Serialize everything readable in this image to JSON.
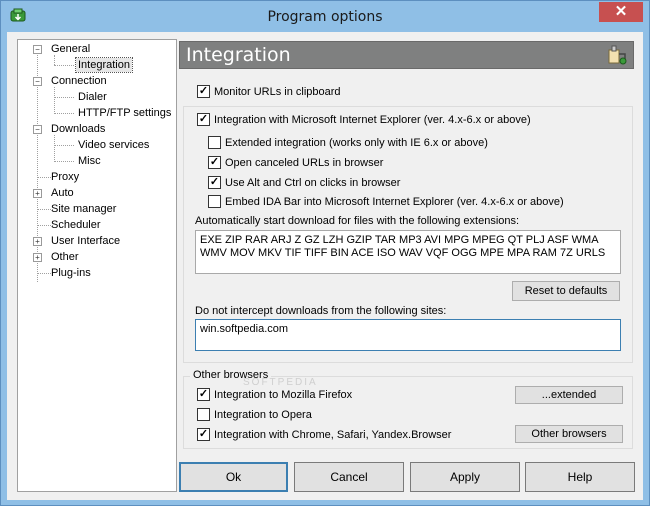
{
  "window": {
    "title": "Program options",
    "close_glyph": "✕"
  },
  "sidebar": {
    "items": [
      {
        "label": "General",
        "expanded": true
      },
      {
        "label": "Integration",
        "selected": true
      },
      {
        "label": "Connection",
        "expanded": true
      },
      {
        "label": "Dialer"
      },
      {
        "label": "HTTP/FTP settings"
      },
      {
        "label": "Downloads",
        "expanded": true
      },
      {
        "label": "Video services"
      },
      {
        "label": "Misc"
      },
      {
        "label": "Proxy"
      },
      {
        "label": "Auto",
        "collapsed": true
      },
      {
        "label": "Site manager"
      },
      {
        "label": "Scheduler"
      },
      {
        "label": "User Interface",
        "collapsed": true
      },
      {
        "label": "Other",
        "collapsed": true
      },
      {
        "label": "Plug-ins"
      }
    ]
  },
  "panel": {
    "title": "Integration",
    "icon": "plugin-settings-icon",
    "header_color": "#7f8080",
    "monitor_clipboard": {
      "label": "Monitor URLs in clipboard",
      "checked": true
    },
    "ie": {
      "label": "Integration with Microsoft Internet Explorer (ver. 4.x-6.x or above)",
      "checked": true,
      "extended": {
        "label": "Extended integration (works only with IE 6.x or above)",
        "checked": false
      },
      "canceled": {
        "label": "Open canceled URLs in browser",
        "checked": true
      },
      "altctrl": {
        "label": "Use Alt and Ctrl on clicks in browser",
        "checked": true
      },
      "idabar": {
        "label": "Embed IDA Bar into Microsoft Internet Explorer (ver. 4.x-6.x or above)",
        "checked": false
      }
    },
    "extensions": {
      "label": "Automatically start download for files with the following extensions:",
      "value": "EXE ZIP RAR ARJ Z GZ LZH GZIP TAR MP3 AVI MPG MPEG QT PLJ ASF WMA WMV MOV MKV TIF TIFF BIN ACE ISO WAV VQF OGG MPE MPA RAM 7Z URLS"
    },
    "reset_label": "Reset to defaults",
    "exclude": {
      "label": "Do not intercept downloads from the following sites:",
      "value": "win.softpedia.com"
    },
    "other_browsers": {
      "legend": "Other browsers",
      "firefox": {
        "label": "Integration to Mozilla Firefox",
        "checked": true
      },
      "opera": {
        "label": "Integration to Opera",
        "checked": false
      },
      "chrome": {
        "label": "Integration with Chrome, Safari, Yandex.Browser",
        "checked": true
      },
      "extended_button": "...extended",
      "other_button": "Other browsers"
    }
  },
  "footer": {
    "ok": "Ok",
    "cancel": "Cancel",
    "apply": "Apply",
    "help": "Help"
  },
  "colors": {
    "accent": "#3c7fb1",
    "titlebar": "#8fbfe6",
    "close": "#c75050"
  }
}
